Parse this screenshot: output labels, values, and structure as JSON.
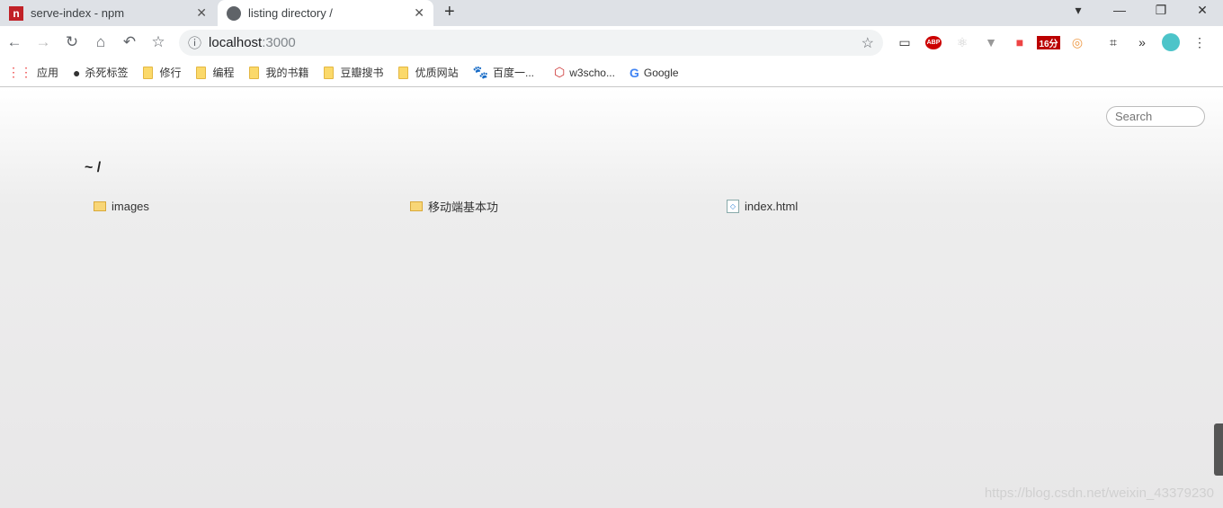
{
  "tabs": [
    {
      "title": "serve-index - npm",
      "icon": "npm-icon"
    },
    {
      "title": "listing directory /",
      "icon": "globe-icon"
    }
  ],
  "address": {
    "host": "localhost",
    "port": ":3000"
  },
  "extensions": {
    "badge": "16分",
    "abp": "ABP"
  },
  "bookmarks": [
    "应用",
    "杀死标签",
    "修行",
    "编程",
    "我的书籍",
    "豆瓣搜书",
    "优质网站",
    "百度一...",
    "w3scho...",
    "Google"
  ],
  "page": {
    "search_placeholder": "Search",
    "heading": "~ /",
    "files": [
      {
        "name": "images",
        "type": "folder"
      },
      {
        "name": "移动端基本功",
        "type": "folder"
      },
      {
        "name": "index.html",
        "type": "file"
      }
    ]
  },
  "watermark": "https://blog.csdn.net/weixin_43379230"
}
